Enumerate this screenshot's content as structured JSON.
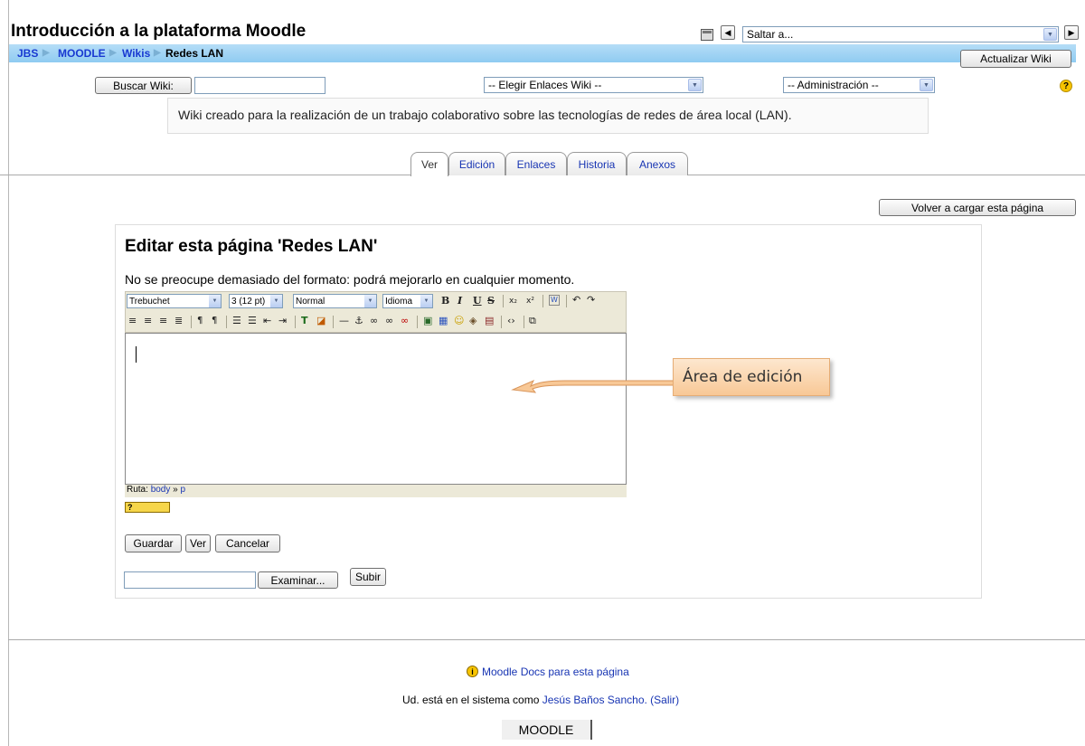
{
  "header": {
    "title": "Introducción a la plataforma Moodle",
    "jump_placeholder": "Saltar a...",
    "update_button": "Actualizar Wiki"
  },
  "breadcrumb": [
    {
      "label": "JBS"
    },
    {
      "label": "MOODLE"
    },
    {
      "label": "Wikis"
    },
    {
      "label": "Redes LAN"
    }
  ],
  "breadcrumb_separator": "▶",
  "wiki_bar": {
    "search_button": "Buscar Wiki:",
    "search_value": "",
    "links_select": "-- Elegir Enlaces Wiki --",
    "admin_select": "-- Administración --",
    "help_icon": "question-icon"
  },
  "description": "Wiki creado para la realización de un trabajo colaborativo sobre las tecnologías de redes de área local (LAN).",
  "tabs": [
    {
      "label": "Ver",
      "active": true
    },
    {
      "label": "Edición",
      "active": false
    },
    {
      "label": "Enlaces",
      "active": false
    },
    {
      "label": "Historia",
      "active": false
    },
    {
      "label": "Anexos",
      "active": false
    }
  ],
  "reload_button": "Volver a cargar esta página",
  "edit": {
    "heading": "Editar esta página 'Redes LAN'",
    "note": "No se preocupe demasiado del formato: podrá mejorarlo en cualquier momento.",
    "font_select": "Trebuchet",
    "size_select": "3 (12 pt)",
    "style_select": "Normal",
    "lang_select": "Idioma",
    "path_label": "Ruta:",
    "path_body": "body",
    "path_sep": "»",
    "path_p": "p",
    "save_button": "Guardar",
    "view_button": "Ver",
    "cancel_button": "Cancelar",
    "browse_button": "Examinar...",
    "upload_button": "Subir"
  },
  "callout": "Área de edición",
  "footer": {
    "docs_link": "Moodle Docs para esta página",
    "login_prefix": "Ud. está en el sistema como",
    "user_name": "Jesús Baños Sancho.",
    "logout": "(Salir)",
    "home_label": "MOODLE"
  },
  "colors": {
    "navbar": "#9fd2f3",
    "link": "#1835b3",
    "callout": "#f8c896"
  }
}
